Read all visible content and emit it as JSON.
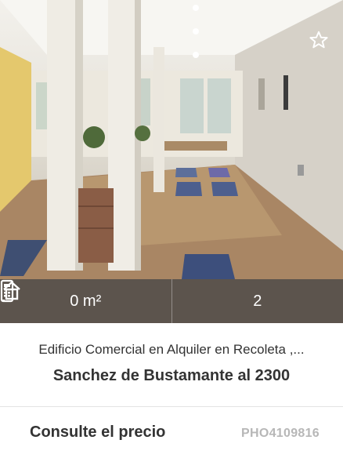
{
  "listing": {
    "area": "0 m²",
    "bathrooms": "2",
    "title": "Edificio Comercial en Alquiler en Recoleta ,...",
    "address": "Sanchez de Bustamante al 2300",
    "price": "Consulte el precio",
    "code": "PHO4109816"
  },
  "icons": {
    "favorite": "star-outline-icon",
    "area": "house-area-icon",
    "bathrooms": "phone-device-icon"
  },
  "colors": {
    "stats_bar": "#464646",
    "text": "#333333",
    "code": "#b7b7b7"
  }
}
